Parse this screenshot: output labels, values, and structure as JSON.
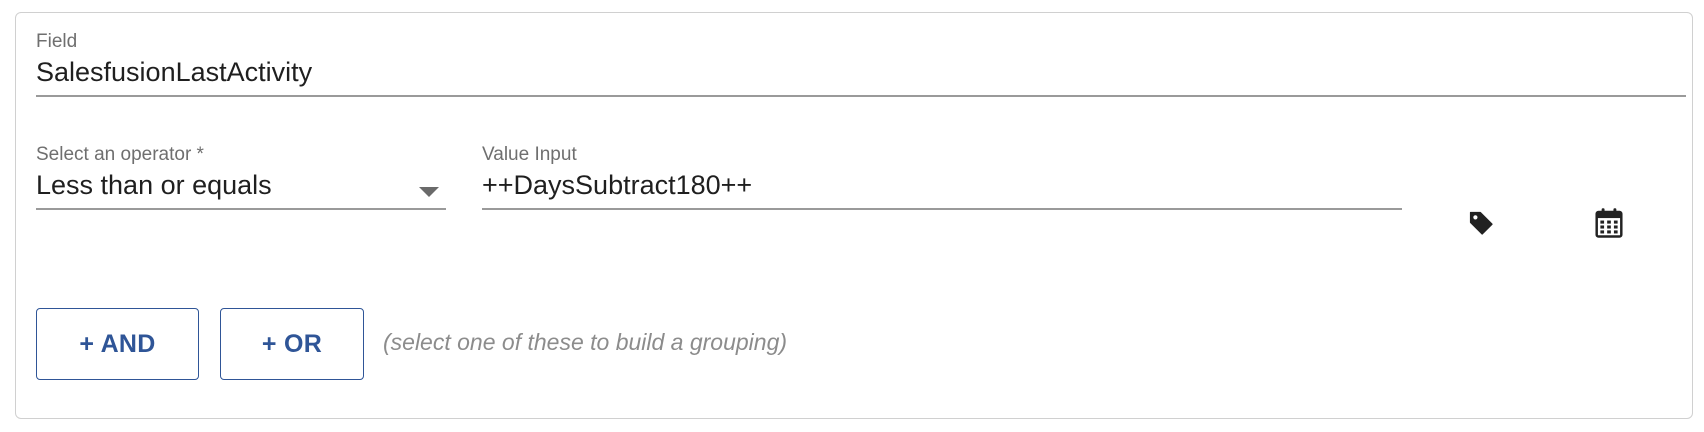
{
  "field": {
    "label": "Field",
    "value": "SalesfusionLastActivity"
  },
  "operator": {
    "label": "Select an operator *",
    "selected": "Less than or equals"
  },
  "value_input": {
    "label": "Value Input",
    "value": "++DaysSubtract180++"
  },
  "icons": {
    "tag": "tag-icon",
    "calendar": "calendar-icon"
  },
  "buttons": {
    "and_label": "+ AND",
    "or_label": "+ OR"
  },
  "hint_text": "(select one of these to build a grouping)",
  "colors": {
    "accent": "#2f5597",
    "label": "#6f6f6f",
    "text": "#1f1f1f",
    "hint": "#8c8c8c"
  }
}
